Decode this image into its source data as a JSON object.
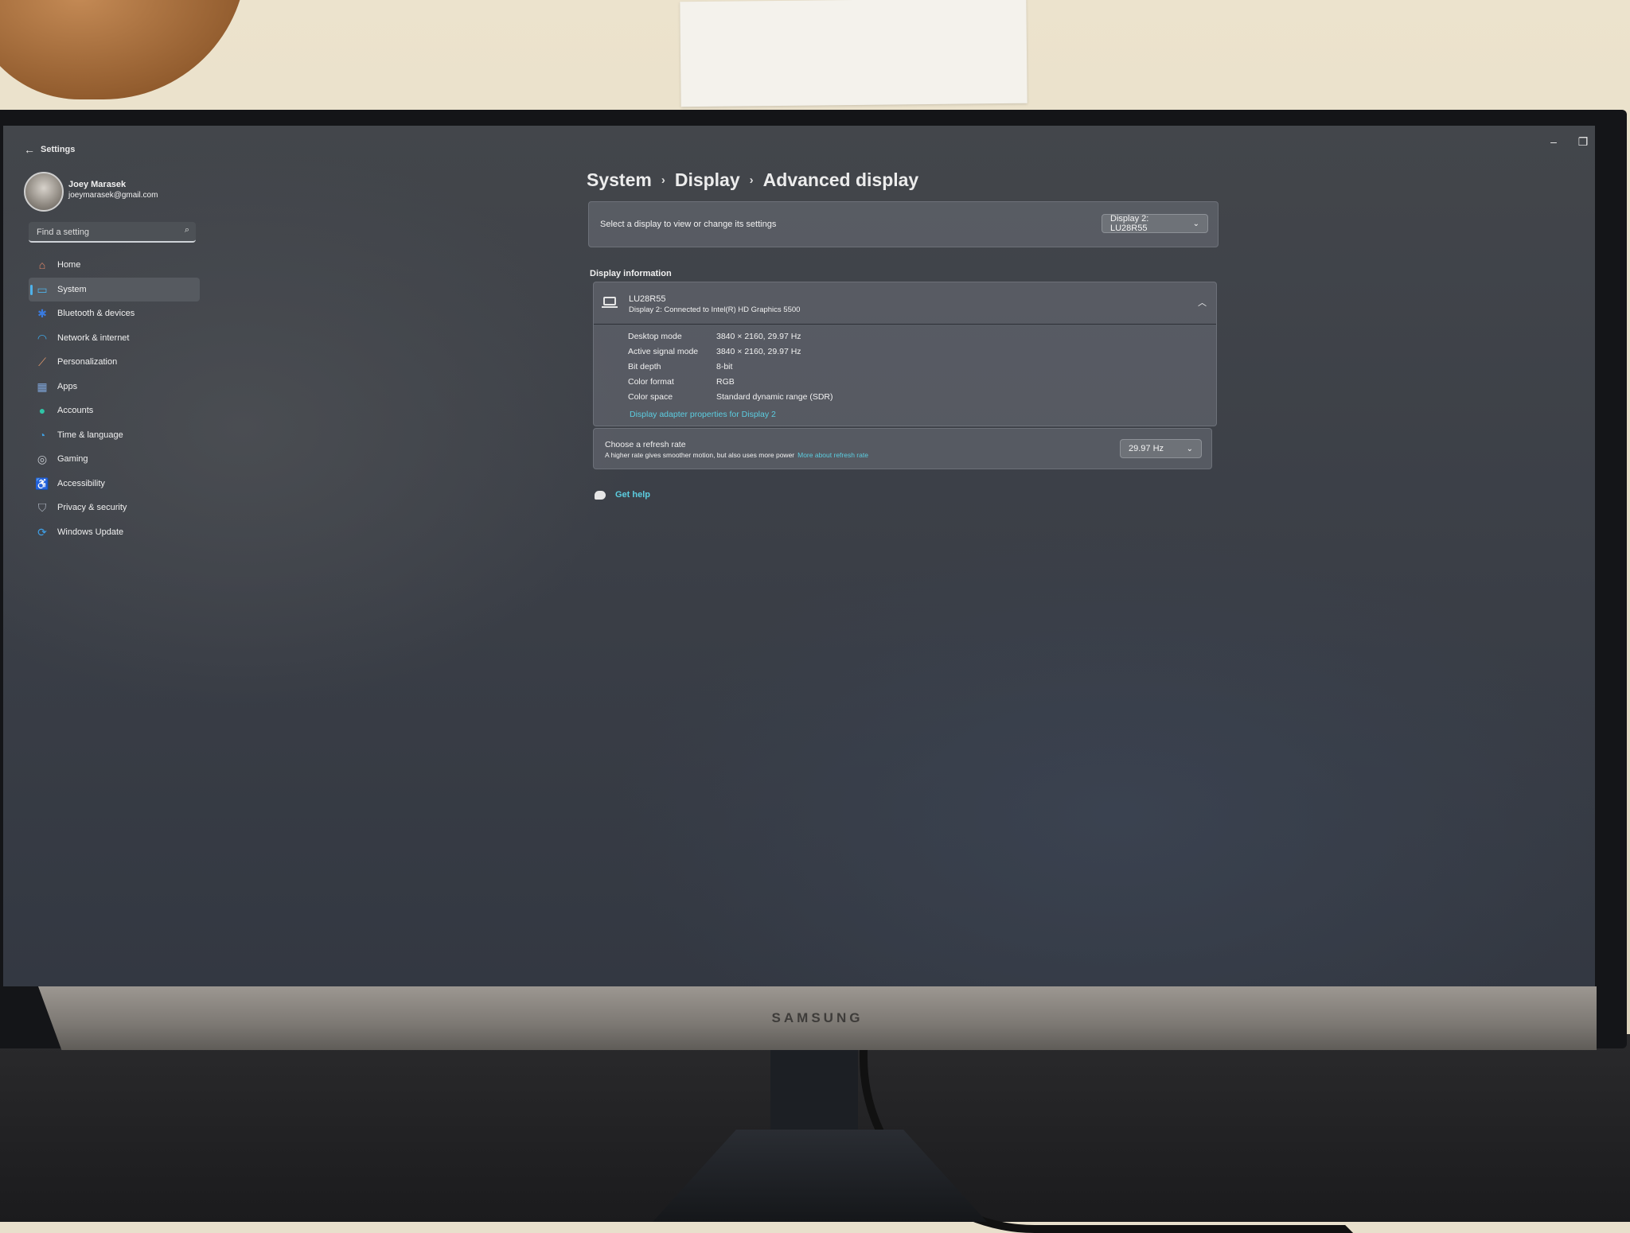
{
  "window": {
    "title": "Settings",
    "controls": {
      "minimize": "–",
      "maximize": "❐",
      "close": "✕"
    }
  },
  "profile": {
    "name": "Joey Marasek",
    "email": "joeymarasek@gmail.com"
  },
  "search": {
    "placeholder": "Find a setting",
    "value": ""
  },
  "sidebar": {
    "items": [
      {
        "label": "Home",
        "icon": "home-icon",
        "glyph": "⌂",
        "color": "#e58a6a",
        "active": false
      },
      {
        "label": "System",
        "icon": "system-icon",
        "glyph": "▭",
        "color": "#4fb2ea",
        "active": true
      },
      {
        "label": "Bluetooth & devices",
        "icon": "bluetooth-icon",
        "glyph": "✱",
        "color": "#3a7be0",
        "active": false
      },
      {
        "label": "Network & internet",
        "icon": "network-icon",
        "glyph": "◠",
        "color": "#3fa7e6",
        "active": false
      },
      {
        "label": "Personalization",
        "icon": "brush-icon",
        "glyph": "⟋",
        "color": "#e59a6d",
        "active": false
      },
      {
        "label": "Apps",
        "icon": "apps-icon",
        "glyph": "▦",
        "color": "#7ea3d6",
        "active": false
      },
      {
        "label": "Accounts",
        "icon": "accounts-icon",
        "glyph": "●",
        "color": "#2fc4a6",
        "active": false
      },
      {
        "label": "Time & language",
        "icon": "clock-globe-icon",
        "glyph": "◔",
        "color": "#3f9ee0",
        "active": false
      },
      {
        "label": "Gaming",
        "icon": "gamepad-icon",
        "glyph": "◎",
        "color": "#c9ccd2",
        "active": false
      },
      {
        "label": "Accessibility",
        "icon": "accessibility-icon",
        "glyph": "♿",
        "color": "#3f8fe0",
        "active": false
      },
      {
        "label": "Privacy & security",
        "icon": "shield-icon",
        "glyph": "⛉",
        "color": "#aab1bc",
        "active": false
      },
      {
        "label": "Windows Update",
        "icon": "update-icon",
        "glyph": "⟳",
        "color": "#3fa0e8",
        "active": false
      }
    ]
  },
  "breadcrumb": {
    "items": [
      "System",
      "Display",
      "Advanced display"
    ],
    "separator": "›"
  },
  "display_select": {
    "label": "Select a display to view or change its settings",
    "selected": "Display 2: LU28R55"
  },
  "display_information": {
    "section_title": "Display information",
    "name": "LU28R55",
    "connection": "Display 2: Connected to Intel(R) HD Graphics 5500",
    "rows": [
      {
        "key": "Desktop mode",
        "value": "3840 × 2160, 29.97 Hz"
      },
      {
        "key": "Active signal mode",
        "value": "3840 × 2160, 29.97 Hz"
      },
      {
        "key": "Bit depth",
        "value": "8-bit"
      },
      {
        "key": "Color format",
        "value": "RGB"
      },
      {
        "key": "Color space",
        "value": "Standard dynamic range (SDR)"
      }
    ],
    "adapter_link": "Display adapter properties for Display 2"
  },
  "refresh_rate": {
    "title": "Choose a refresh rate",
    "description": "A higher rate gives smoother motion, but also uses more power",
    "link": "More about refresh rate",
    "selected": "29.97 Hz"
  },
  "help": {
    "label": "Get help"
  },
  "hardware": {
    "brand": "SAMSUNG"
  },
  "colors": {
    "accent_link": "#5ccde0",
    "active_indicator": "#4fb2ea"
  }
}
